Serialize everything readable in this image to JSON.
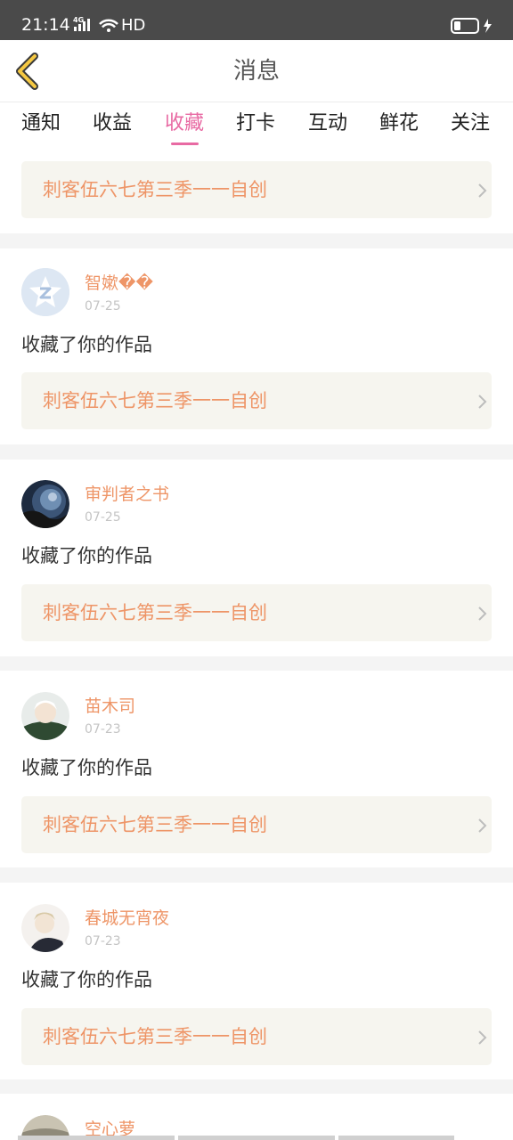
{
  "status_bar": {
    "time": "21:14",
    "network": "4G",
    "hd": "HD"
  },
  "header": {
    "title": "消息"
  },
  "tabs": [
    {
      "label": "通知"
    },
    {
      "label": "收益"
    },
    {
      "label": "收藏",
      "active": true
    },
    {
      "label": "打卡"
    },
    {
      "label": "互动"
    },
    {
      "label": "鲜花"
    },
    {
      "label": "关注"
    }
  ],
  "work_title": "刺客伍六七第三季一一自创",
  "action_text": "收藏了你的作品",
  "entries": [
    {
      "name": "智嫰��",
      "date": "07-25"
    },
    {
      "name": "审判者之书",
      "date": "07-25"
    },
    {
      "name": "苗木司",
      "date": "07-23"
    },
    {
      "name": "春城无宵夜",
      "date": "07-23"
    },
    {
      "name": "空心萝",
      "date": ""
    }
  ],
  "colors": {
    "accent": "#e86aa3",
    "name": "#ee9567",
    "card_bg": "#f6f5ef",
    "back_icon": "#f5c842"
  }
}
